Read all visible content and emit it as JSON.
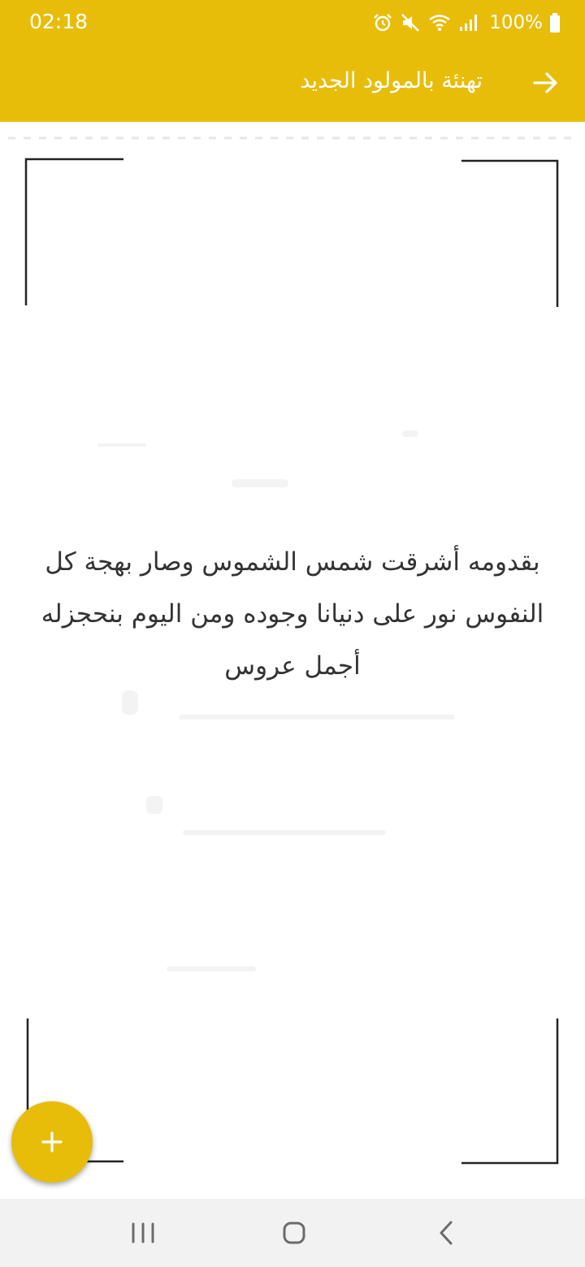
{
  "status_bar": {
    "time": "02:18",
    "battery": "100%",
    "icons": [
      "alarm-icon",
      "mute-icon",
      "wifi-icon",
      "signal-icon",
      "battery-icon"
    ]
  },
  "app_bar": {
    "title": "تهنئة بالمولود الجديد",
    "back_icon": "arrow-right-icon"
  },
  "content": {
    "message": "بقدومه أشرقت شمس الشموس وصار بهجة كل النفوس نور على دنيانا وجوده ومن اليوم بنحجزله أجمل عروس"
  },
  "fab": {
    "icon": "plus-icon"
  },
  "navigation": {
    "buttons": [
      "recent-apps-icon",
      "home-icon",
      "back-icon"
    ]
  },
  "colors": {
    "accent": "#e8bd0a",
    "text": "#333333",
    "nav_background": "#f2f2f2"
  }
}
